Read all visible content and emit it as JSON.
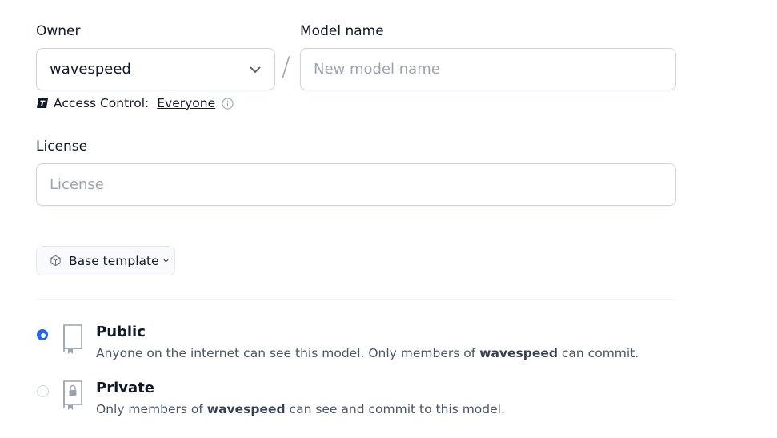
{
  "owner": {
    "label": "Owner",
    "value": "wavespeed"
  },
  "model_name": {
    "label": "Model name",
    "placeholder": "New model name"
  },
  "separator": "/",
  "access_control": {
    "label": "Access Control:",
    "value": "Everyone"
  },
  "license": {
    "label": "License",
    "placeholder": "License"
  },
  "base_template": {
    "label": "Base template"
  },
  "visibility": {
    "selected": "public",
    "options": [
      {
        "id": "public",
        "title": "Public",
        "desc_before": "Anyone on the internet can see this model. Only members of ",
        "desc_org": "wavespeed",
        "desc_after": " can commit."
      },
      {
        "id": "private",
        "title": "Private",
        "desc_before": "Only members of ",
        "desc_org": "wavespeed",
        "desc_after": " can see and commit to this model."
      }
    ]
  },
  "colors": {
    "accent": "#2563eb",
    "border": "#d1d5db",
    "muted": "#9ca3af"
  },
  "icons": [
    "chevron-down-icon",
    "enterprise-icon",
    "info-icon",
    "cube-icon",
    "book-icon",
    "lock-book-icon"
  ]
}
